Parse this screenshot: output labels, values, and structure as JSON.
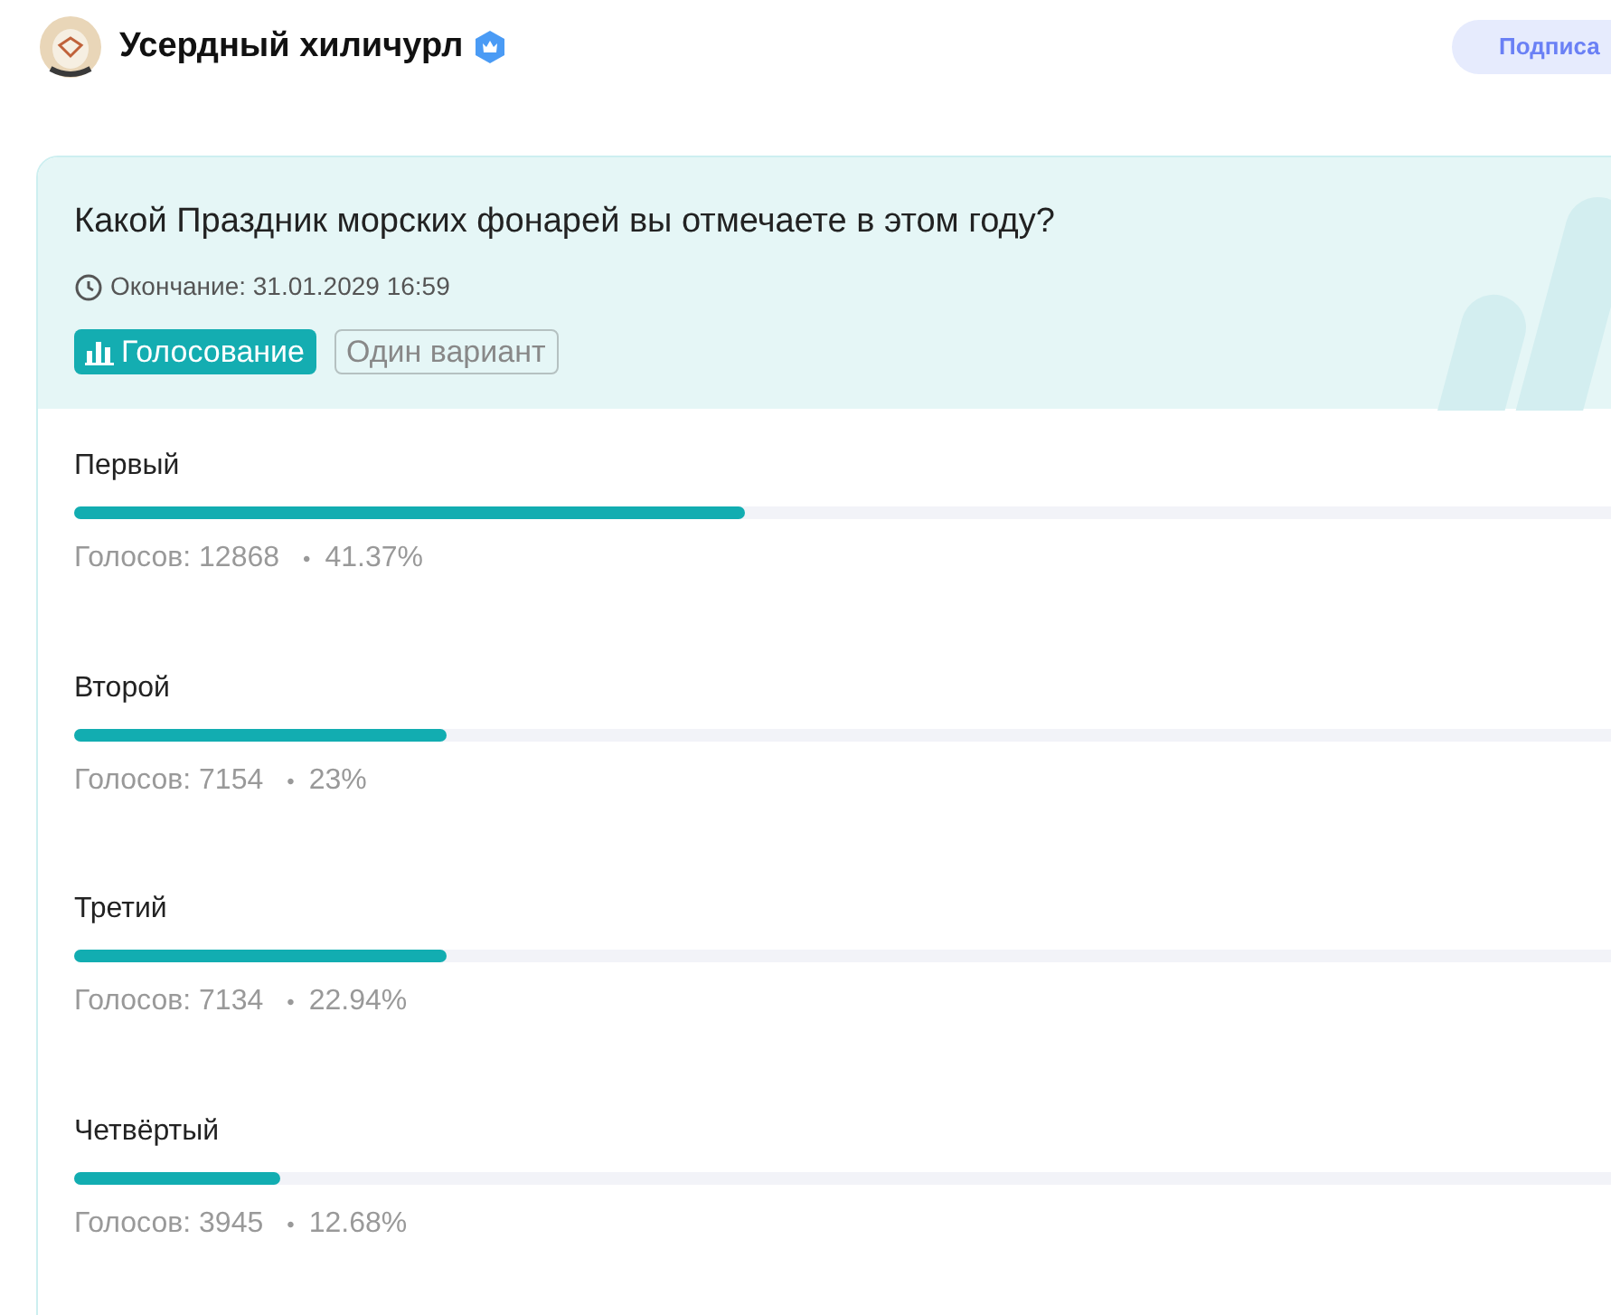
{
  "author": {
    "name": "Усердный хиличурл",
    "verified": true
  },
  "subscribe_button": "Подписа",
  "poll": {
    "question": "Какой Праздник морских фонарей вы отмечаете в этом году?",
    "deadline": "Окончание: 31.01.2029 16:59",
    "tags": [
      {
        "kind": "vote",
        "label": "Голосование"
      },
      {
        "kind": "mode",
        "label": "Один вариант"
      }
    ],
    "options": [
      {
        "label": "Первый",
        "level": 0.4137,
        "votes": "Голосов: 12868",
        "separator": "•",
        "percent": "41.37%"
      },
      {
        "label": "Второй",
        "level": 0.23,
        "votes": "Голосов: 7154",
        "separator": "•",
        "percent": "23%"
      },
      {
        "label": "Третий",
        "level": 0.2294,
        "votes": "Голосов: 7134",
        "separator": "•",
        "percent": "22.94%"
      },
      {
        "label": "Четвёртый",
        "level": 0.1268,
        "votes": "Голосов: 3945",
        "separator": "•",
        "percent": "12.68%"
      }
    ]
  }
}
